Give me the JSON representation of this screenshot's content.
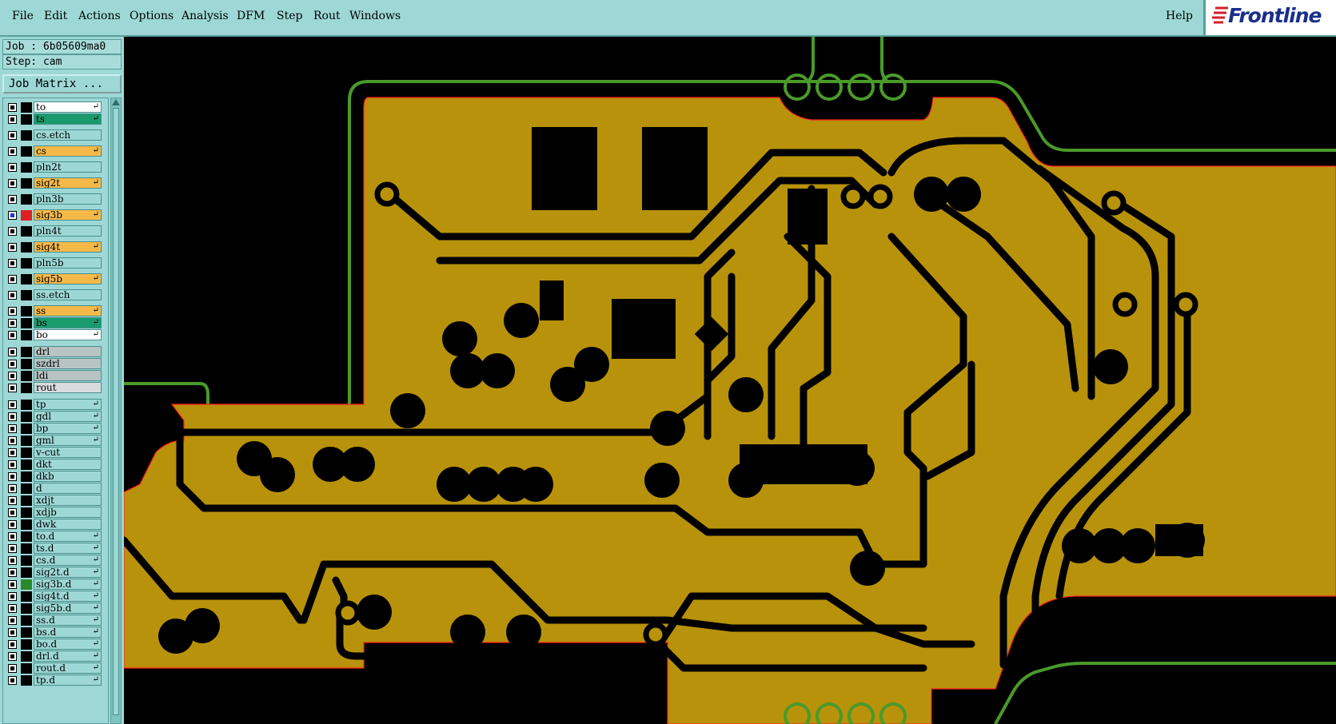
{
  "menu": {
    "items": [
      "File",
      "Edit",
      "Actions",
      "Options",
      "Analysis",
      "DFM",
      "Step",
      "Rout",
      "Windows"
    ],
    "help": "Help",
    "logo_text": "Frontline"
  },
  "job": {
    "job_line": "Job : 6b05609ma0",
    "step_line": "Step: cam",
    "job_matrix_button": "Job Matrix ..."
  },
  "layers": [
    {
      "name": "to",
      "bg": "#ffffff",
      "arrow": true
    },
    {
      "name": "ts",
      "bg": "#1a9b6e",
      "arrow": true
    },
    {
      "name": "cs.etch",
      "bg": "#9dd8d6",
      "arrow": false
    },
    {
      "name": "cs",
      "bg": "#f5b94a",
      "arrow": true
    },
    {
      "name": "pln2t",
      "bg": "#9dd8d6",
      "arrow": false
    },
    {
      "name": "sig2t",
      "bg": "#f5b94a",
      "arrow": true
    },
    {
      "name": "pln3b",
      "bg": "#9dd8d6",
      "arrow": false
    },
    {
      "name": "sig3b",
      "bg": "#f5b94a",
      "arrow": true,
      "active": true
    },
    {
      "name": "pln4t",
      "bg": "#9dd8d6",
      "arrow": false
    },
    {
      "name": "sig4t",
      "bg": "#f5b94a",
      "arrow": true
    },
    {
      "name": "pln5b",
      "bg": "#9dd8d6",
      "arrow": false
    },
    {
      "name": "sig5b",
      "bg": "#f5b94a",
      "arrow": true
    },
    {
      "name": "ss.etch",
      "bg": "#9dd8d6",
      "arrow": false
    },
    {
      "name": "ss",
      "bg": "#f5b94a",
      "arrow": true
    },
    {
      "name": "bs",
      "bg": "#1a9b6e",
      "arrow": true
    },
    {
      "name": "bo",
      "bg": "#ffffff",
      "arrow": true
    },
    {
      "name": "drl",
      "bg": "#b8c4c4",
      "arrow": false
    },
    {
      "name": "szdrl",
      "bg": "#b8c4c4",
      "arrow": false
    },
    {
      "name": "ldi",
      "bg": "#b8c4c4",
      "arrow": false
    },
    {
      "name": "rout",
      "bg": "#d8dcdc",
      "arrow": false
    },
    {
      "name": "tp",
      "bg": "#9dd8d6",
      "arrow": true
    },
    {
      "name": "gdl",
      "bg": "#9dd8d6",
      "arrow": true
    },
    {
      "name": "bp",
      "bg": "#9dd8d6",
      "arrow": true
    },
    {
      "name": "gml",
      "bg": "#9dd8d6",
      "arrow": true
    },
    {
      "name": "v-cut",
      "bg": "#9dd8d6",
      "arrow": false
    },
    {
      "name": "dkt",
      "bg": "#9dd8d6",
      "arrow": false
    },
    {
      "name": "dkb",
      "bg": "#9dd8d6",
      "arrow": false
    },
    {
      "name": "d",
      "bg": "#9dd8d6",
      "arrow": false
    },
    {
      "name": "xdjt",
      "bg": "#9dd8d6",
      "arrow": false
    },
    {
      "name": "xdjb",
      "bg": "#9dd8d6",
      "arrow": false
    },
    {
      "name": "dwk",
      "bg": "#9dd8d6",
      "arrow": false
    },
    {
      "name": "to.d",
      "bg": "#9dd8d6",
      "arrow": true
    },
    {
      "name": "ts.d",
      "bg": "#9dd8d6",
      "arrow": true
    },
    {
      "name": "cs.d",
      "bg": "#9dd8d6",
      "arrow": true
    },
    {
      "name": "sig2t.d",
      "bg": "#9dd8d6",
      "arrow": true
    },
    {
      "name": "sig3b.d",
      "bg": "#9dd8d6",
      "arrow": true,
      "colorbox": "#2a8a2a"
    },
    {
      "name": "sig4t.d",
      "bg": "#9dd8d6",
      "arrow": true
    },
    {
      "name": "sig5b.d",
      "bg": "#9dd8d6",
      "arrow": true
    },
    {
      "name": "ss.d",
      "bg": "#9dd8d6",
      "arrow": true
    },
    {
      "name": "bs.d",
      "bg": "#9dd8d6",
      "arrow": true
    },
    {
      "name": "bo.d",
      "bg": "#9dd8d6",
      "arrow": true
    },
    {
      "name": "drl.d",
      "bg": "#9dd8d6",
      "arrow": true
    },
    {
      "name": "rout.d",
      "bg": "#9dd8d6",
      "arrow": true
    },
    {
      "name": "tp.d",
      "bg": "#9dd8d6",
      "arrow": true
    }
  ],
  "colors": {
    "copper": "#b8920a",
    "outline": "#4a9a2a",
    "edge": "#ff2020",
    "background": "#000000"
  }
}
